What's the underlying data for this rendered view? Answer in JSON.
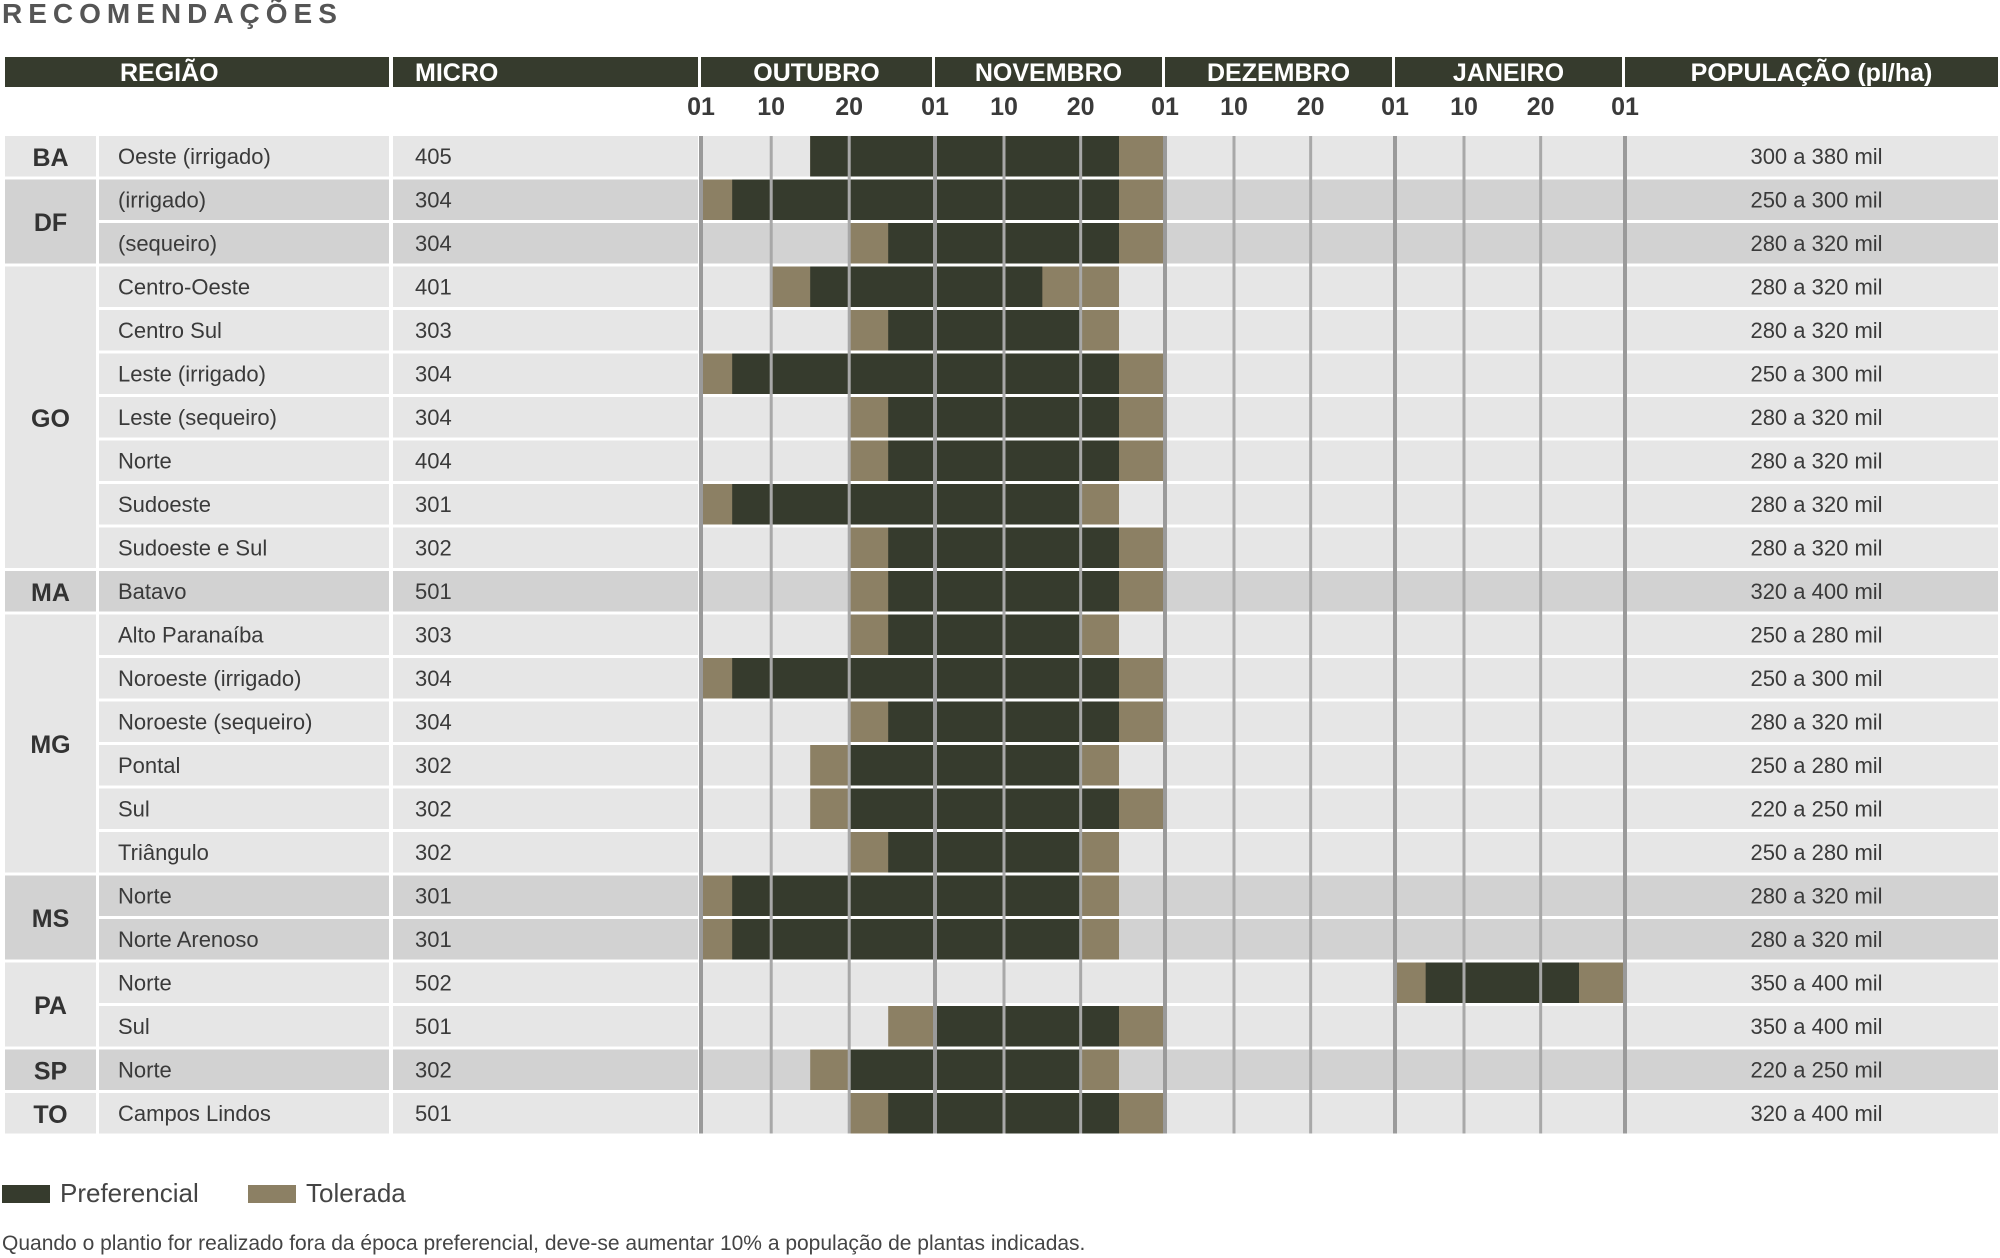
{
  "title": "RECOMENDAÇÕES",
  "legend": {
    "preferred_label": "Preferencial",
    "tolerated_label": "Tolerada"
  },
  "footnote": "Quando o plantio for realizado fora da época preferencial, deve-se aumentar 10% a população de plantas indicadas.",
  "chart_data": {
    "type": "table",
    "subtype": "planting-calendar",
    "columns": [
      "REGIÃO",
      "MICRO",
      "OUTUBRO",
      "NOVEMBRO",
      "DEZEMBRO",
      "JANEIRO",
      "POPULAÇÃO (pl/ha)"
    ],
    "months": [
      "OUTUBRO",
      "NOVEMBRO",
      "DEZEMBRO",
      "JANEIRO"
    ],
    "date_ticks": [
      "01",
      "10",
      "20",
      "01",
      "10",
      "20",
      "01",
      "10",
      "20",
      "01",
      "10",
      "20",
      "01"
    ],
    "colors": {
      "preferred": "#363b2d",
      "tolerated": "#8c8064",
      "header": "#363b2d",
      "row_light": "#e6e6e6",
      "row_dark": "#d2d2d2"
    },
    "groups": [
      {
        "state": "BA",
        "rows": [
          {
            "region": "Oeste (irrigado)",
            "micro": "405",
            "tolerated_start": "Oct 15",
            "preferred_start": "Oct 15",
            "preferred_end": "Nov 25",
            "tolerated_end": "Dec 1",
            "population": "300 a 380 mil"
          }
        ]
      },
      {
        "state": "DF",
        "rows": [
          {
            "region": "(irrigado)",
            "micro": "304",
            "tolerated_start": "Oct 1",
            "preferred_start": "Oct 5",
            "preferred_end": "Nov 25",
            "tolerated_end": "Dec 1",
            "population": "250 a 300 mil"
          },
          {
            "region": "(sequeiro)",
            "micro": "304",
            "tolerated_start": "Oct 20",
            "preferred_start": "Oct 25",
            "preferred_end": "Nov 25",
            "tolerated_end": "Dec 1",
            "population": "280 a 320 mil"
          }
        ]
      },
      {
        "state": "GO",
        "rows": [
          {
            "region": "Centro-Oeste",
            "micro": "401",
            "tolerated_start": "Oct 10",
            "preferred_start": "Oct 15",
            "preferred_end": "Nov 15",
            "tolerated_end": "Nov 25",
            "population": "280 a 320 mil"
          },
          {
            "region": "Centro Sul",
            "micro": "303",
            "tolerated_start": "Oct 20",
            "preferred_start": "Oct 25",
            "preferred_end": "Nov 20",
            "tolerated_end": "Nov 25",
            "population": "280 a 320 mil"
          },
          {
            "region": "Leste (irrigado)",
            "micro": "304",
            "tolerated_start": "Oct 1",
            "preferred_start": "Oct 5",
            "preferred_end": "Nov 25",
            "tolerated_end": "Dec 1",
            "population": "250 a 300 mil"
          },
          {
            "region": "Leste (sequeiro)",
            "micro": "304",
            "tolerated_start": "Oct 20",
            "preferred_start": "Oct 25",
            "preferred_end": "Nov 25",
            "tolerated_end": "Dec 1",
            "population": "280 a 320 mil"
          },
          {
            "region": "Norte",
            "micro": "404",
            "tolerated_start": "Oct 20",
            "preferred_start": "Oct 25",
            "preferred_end": "Nov 25",
            "tolerated_end": "Dec 1",
            "population": "280 a 320 mil"
          },
          {
            "region": "Sudoeste",
            "micro": "301",
            "tolerated_start": "Oct 1",
            "preferred_start": "Oct 5",
            "preferred_end": "Nov 20",
            "tolerated_end": "Nov 25",
            "population": "280 a 320 mil"
          },
          {
            "region": "Sudoeste e Sul",
            "micro": "302",
            "tolerated_start": "Oct 20",
            "preferred_start": "Oct 25",
            "preferred_end": "Nov 25",
            "tolerated_end": "Dec 1",
            "population": "280 a 320 mil"
          }
        ]
      },
      {
        "state": "MA",
        "rows": [
          {
            "region": "Batavo",
            "micro": "501",
            "tolerated_start": "Oct 20",
            "preferred_start": "Oct 25",
            "preferred_end": "Nov 25",
            "tolerated_end": "Dec 1",
            "population": "320 a 400 mil"
          }
        ]
      },
      {
        "state": "MG",
        "rows": [
          {
            "region": "Alto Paranaíba",
            "micro": "303",
            "tolerated_start": "Oct 20",
            "preferred_start": "Oct 25",
            "preferred_end": "Nov 20",
            "tolerated_end": "Nov 25",
            "population": "250 a 280 mil"
          },
          {
            "region": "Noroeste (irrigado)",
            "micro": "304",
            "tolerated_start": "Oct 1",
            "preferred_start": "Oct 5",
            "preferred_end": "Nov 25",
            "tolerated_end": "Dec 1",
            "population": "250 a 300 mil"
          },
          {
            "region": "Noroeste (sequeiro)",
            "micro": "304",
            "tolerated_start": "Oct 20",
            "preferred_start": "Oct 25",
            "preferred_end": "Nov 25",
            "tolerated_end": "Dec 1",
            "population": "280 a 320 mil"
          },
          {
            "region": "Pontal",
            "micro": "302",
            "tolerated_start": "Oct 15",
            "preferred_start": "Oct 20",
            "preferred_end": "Nov 20",
            "tolerated_end": "Nov 25",
            "population": "250 a 280 mil"
          },
          {
            "region": "Sul",
            "micro": "302",
            "tolerated_start": "Oct 15",
            "preferred_start": "Oct 20",
            "preferred_end": "Nov 25",
            "tolerated_end": "Dec 1",
            "population": "220 a 250 mil"
          },
          {
            "region": "Triângulo",
            "micro": "302",
            "tolerated_start": "Oct 20",
            "preferred_start": "Oct 25",
            "preferred_end": "Nov 20",
            "tolerated_end": "Nov 25",
            "population": "250 a 280 mil"
          }
        ]
      },
      {
        "state": "MS",
        "rows": [
          {
            "region": "Norte",
            "micro": "301",
            "tolerated_start": "Oct 1",
            "preferred_start": "Oct 5",
            "preferred_end": "Nov 20",
            "tolerated_end": "Nov 25",
            "population": "280 a 320 mil"
          },
          {
            "region": "Norte Arenoso",
            "micro": "301",
            "tolerated_start": "Oct 1",
            "preferred_start": "Oct 5",
            "preferred_end": "Nov 20",
            "tolerated_end": "Nov 25",
            "population": "280 a 320 mil"
          }
        ]
      },
      {
        "state": "PA",
        "rows": [
          {
            "region": "Norte",
            "micro": "502",
            "tolerated_start": "Jan 1",
            "preferred_start": "Jan 5",
            "preferred_end": "Jan 25",
            "tolerated_end": "Feb 1",
            "population": "350 a 400 mil"
          },
          {
            "region": "Sul",
            "micro": "501",
            "tolerated_start": "Oct 25",
            "preferred_start": "Nov 1",
            "preferred_end": "Nov 25",
            "tolerated_end": "Dec 1",
            "population": "350 a 400 mil"
          }
        ]
      },
      {
        "state": "SP",
        "rows": [
          {
            "region": "Norte",
            "micro": "302",
            "tolerated_start": "Oct 15",
            "preferred_start": "Oct 20",
            "preferred_end": "Nov 20",
            "tolerated_end": "Nov 25",
            "population": "220 a 250 mil"
          }
        ]
      },
      {
        "state": "TO",
        "rows": [
          {
            "region": "Campos Lindos",
            "micro": "501",
            "tolerated_start": "Oct 20",
            "preferred_start": "Oct 25",
            "preferred_end": "Nov 25",
            "tolerated_end": "Dec 1",
            "population": "320 a 400 mil"
          }
        ]
      }
    ]
  }
}
